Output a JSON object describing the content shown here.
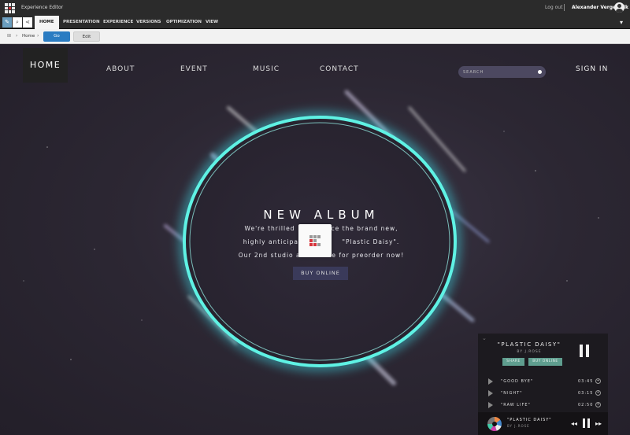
{
  "editor": {
    "title": "Experience Editor",
    "logout": "Log out",
    "user": "Alexander Vergeichik",
    "tabs": [
      "HOME",
      "PRESENTATION",
      "EXPERIENCE",
      "VERSIONS",
      "OPTIMIZATION",
      "VIEW"
    ],
    "breadcrumb_home": "Home",
    "go_label": "Go",
    "edit_label": "Edit"
  },
  "site": {
    "nav_home": "HOME",
    "nav": [
      "ABOUT",
      "EVENT",
      "MUSIC",
      "CONTACT"
    ],
    "search_placeholder": "SEARCH",
    "signin": "SIGN IN",
    "hero": {
      "title": "NEW ALBUM",
      "line1": "We're thrilled",
      "line1b": "ce the brand new,",
      "line2": "highly anticipate",
      "line2b": "\"Plastic Daisy\".",
      "line3": "Our 2nd studio album",
      "line3b": "ble for preorder now!",
      "cta": "BUY ONLINE"
    }
  },
  "player": {
    "album": "\"PLASTIC DAISY\"",
    "by": "BY J.ROSE",
    "btn_share": "SHARE",
    "btn_buy": "BUY ONLINE",
    "tracks": [
      {
        "name": "\"GOOD BYE\"",
        "time": "03:45"
      },
      {
        "name": "\"NIGHT\"",
        "time": "03:15"
      },
      {
        "name": "\"RAW LIFE\"",
        "time": "02:50"
      }
    ],
    "now_title": "\"PLASTIC DAISY\"",
    "now_sub": "BY J.ROSE"
  },
  "colors": {
    "accent_blue": "#2b7cc2",
    "ring": "#4fe3d6",
    "player_btn": "#5f9e8f"
  }
}
